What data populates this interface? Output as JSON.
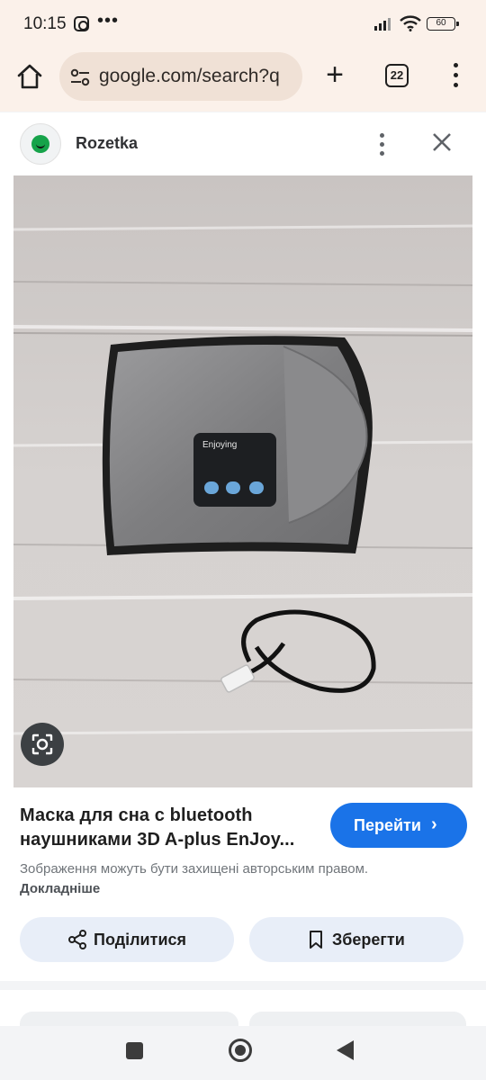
{
  "status_bar": {
    "time": "10:15",
    "battery": "60",
    "icons": [
      "instagram-icon",
      "more-dots-icon",
      "signal-icon",
      "wifi-icon",
      "battery-icon"
    ]
  },
  "browser": {
    "url": "google.com/search?q",
    "tab_count": "22",
    "icons": [
      "home-icon",
      "site-info-icon",
      "new-tab-plus-icon",
      "tabs-icon",
      "menu-icon"
    ]
  },
  "result": {
    "source_name": "Rozetka",
    "title": "Маска для сна с bluetooth наушниками 3D A-plus EnJoy...",
    "visit_label": "Перейти",
    "copyright_text": "Зображення можуть бути захищені авторським правом.",
    "more_link": "Докладніше",
    "share_label": "Поділитися",
    "save_label": "Зберегти",
    "image": {
      "device_text": "Enjoying",
      "description_colors": {
        "mask": "#8a8a8c",
        "trim": "#1e1e1e",
        "background": "#d4d0ce"
      }
    }
  },
  "colors": {
    "accent": "#1a73e8",
    "toolbar_bg": "#fbf1ea",
    "pill_button_bg": "#e8eef8"
  }
}
